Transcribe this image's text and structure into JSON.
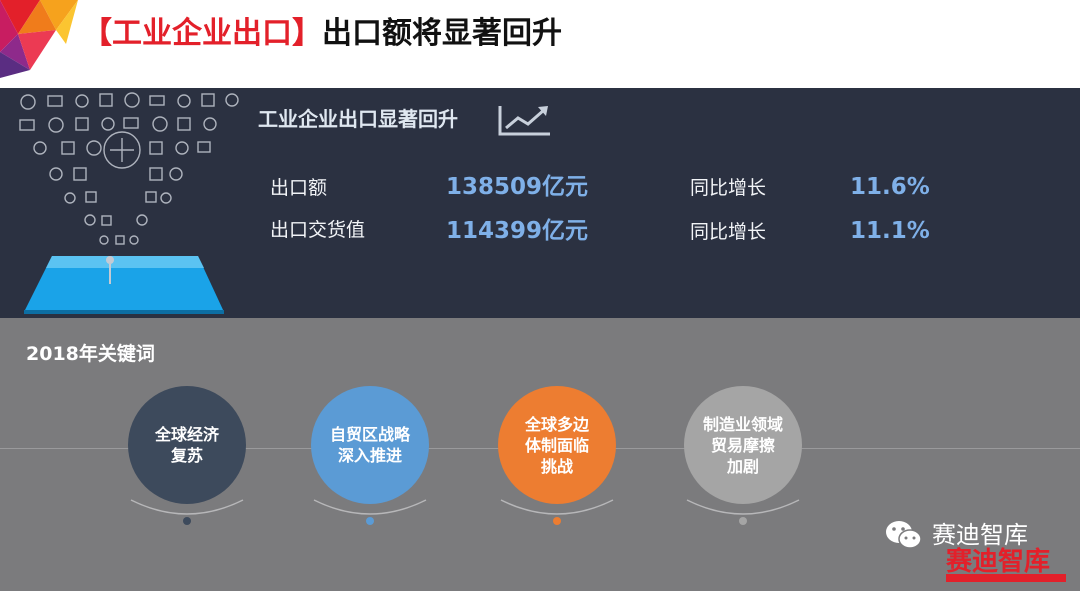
{
  "header": {
    "title_accent": "【工业企业出口】",
    "title_main": "出口额将显著回升",
    "accent_color": "#e3202a"
  },
  "summary": {
    "heading": "工业企业出口显著回升",
    "heading_icon": "trend-up-icon",
    "rows": [
      {
        "label": "出口额",
        "value": "138509亿元",
        "growth_label": "同比增长",
        "growth_value": "11.6%"
      },
      {
        "label": "出口交货值",
        "value": "114399亿元",
        "growth_label": "同比增长",
        "growth_value": "11.1%"
      }
    ]
  },
  "keywords": {
    "heading": "2018年关键词",
    "items": [
      {
        "lines": [
          "全球经济",
          "复苏"
        ],
        "color": "#3d4a5c"
      },
      {
        "lines": [
          "自贸区战略",
          "深入推进"
        ],
        "color": "#5b9bd5"
      },
      {
        "lines": [
          "全球多边",
          "体制面临",
          "挑战"
        ],
        "color": "#ed7d31"
      },
      {
        "lines": [
          "制造业领域",
          "贸易摩擦",
          "加剧"
        ],
        "color": "#a5a5a5"
      }
    ]
  },
  "watermark": {
    "wechat_icon": "wechat-icon",
    "name": "赛迪智库"
  }
}
